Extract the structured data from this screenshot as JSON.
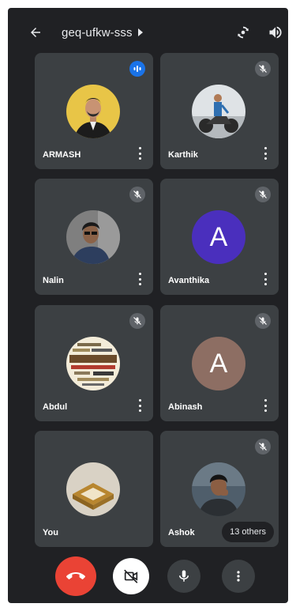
{
  "header": {
    "back_icon": "arrow-back-icon",
    "meeting_code": "geq-ufkw-sss",
    "info_icon": "chevron-right-icon",
    "actions": [
      {
        "icon": "switch-camera-icon"
      },
      {
        "icon": "speaker-volume-icon"
      }
    ]
  },
  "participants": [
    {
      "name": "ARMASH",
      "avatar": "photo",
      "status": "speaking"
    },
    {
      "name": "Karthik",
      "avatar": "photo",
      "status": "muted"
    },
    {
      "name": "Nalin",
      "avatar": "photo",
      "status": "muted"
    },
    {
      "name": "Avanthika",
      "avatar": "letter",
      "letter": "A",
      "avatar_color": "#4a2fbd",
      "status": "muted"
    },
    {
      "name": "Abdul",
      "avatar": "photo",
      "status": "muted"
    },
    {
      "name": "Abinash",
      "avatar": "letter",
      "letter": "A",
      "avatar_color": "#8d6e63",
      "status": "muted"
    },
    {
      "name": "You",
      "avatar": "photo",
      "status": "none"
    },
    {
      "name": "Ashok",
      "avatar": "photo",
      "status": "muted",
      "others_label": "13 others"
    }
  ],
  "controls": [
    {
      "icon": "end-call-icon",
      "color": "#ea4335"
    },
    {
      "icon": "camera-off-icon",
      "color": "#ffffff"
    },
    {
      "icon": "microphone-icon",
      "color": "#3c4043"
    },
    {
      "icon": "more-options-icon",
      "color": "#3c4043"
    }
  ],
  "colors": {
    "background": "#202124",
    "tile": "#3c4043",
    "speaking": "#1a73e8",
    "end_call": "#ea4335"
  }
}
